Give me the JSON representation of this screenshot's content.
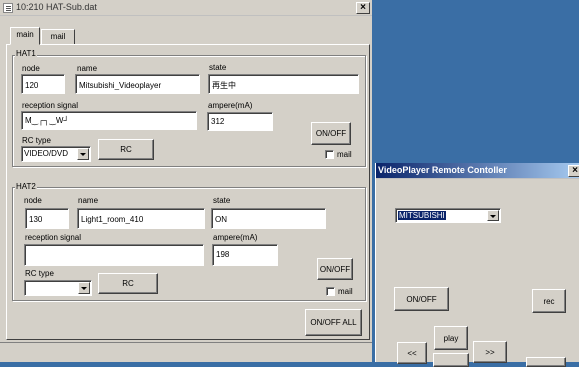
{
  "main_window": {
    "title": "10:210 HAT-Sub.dat",
    "close_label": "×",
    "tabs": [
      {
        "label": "main",
        "active": true
      },
      {
        "label": "mail",
        "active": false
      }
    ],
    "hat1": {
      "group_label": "HAT1",
      "node_label": "node",
      "node_value": "120",
      "name_label": "name",
      "name_value": "Mitsubishi_Videoplayer",
      "state_label": "state",
      "state_value": "再生中",
      "reception_label": "reception signal",
      "reception_value": "M‿┌┐‿W┘",
      "ampere_label": "ampere(mA)",
      "ampere_value": "312",
      "onoff_label": "ON/OFF",
      "rctype_label": "RC type",
      "rctype_value": "VIDEO/DVD",
      "rc_label": "RC",
      "mail_label": "mail"
    },
    "hat2": {
      "group_label": "HAT2",
      "node_label": "node",
      "node_value": "130",
      "name_label": "name",
      "name_value": "Light1_room_410",
      "state_label": "state",
      "state_value": "ON",
      "reception_label": "reception signal",
      "reception_value": "",
      "ampere_label": "ampere(mA)",
      "ampere_value": "198",
      "onoff_label": "ON/OFF",
      "rctype_label": "RC type",
      "rctype_value": "",
      "rc_label": "RC",
      "mail_label": "mail"
    },
    "onoff_all_label": "ON/OFF ALL"
  },
  "remote_window": {
    "title": "VideoPlayer Remote Contoller",
    "close_label": "×",
    "maker_value": "MITSUBISHI",
    "onoff_label": "ON/OFF",
    "rec_label": "rec",
    "play_label": "play",
    "rewind_label": "<<",
    "forward_label": ">>"
  },
  "colors": {
    "desktop": "#3a6ea5",
    "window_face": "#d4d0c8",
    "active_title": "#0a246a"
  }
}
